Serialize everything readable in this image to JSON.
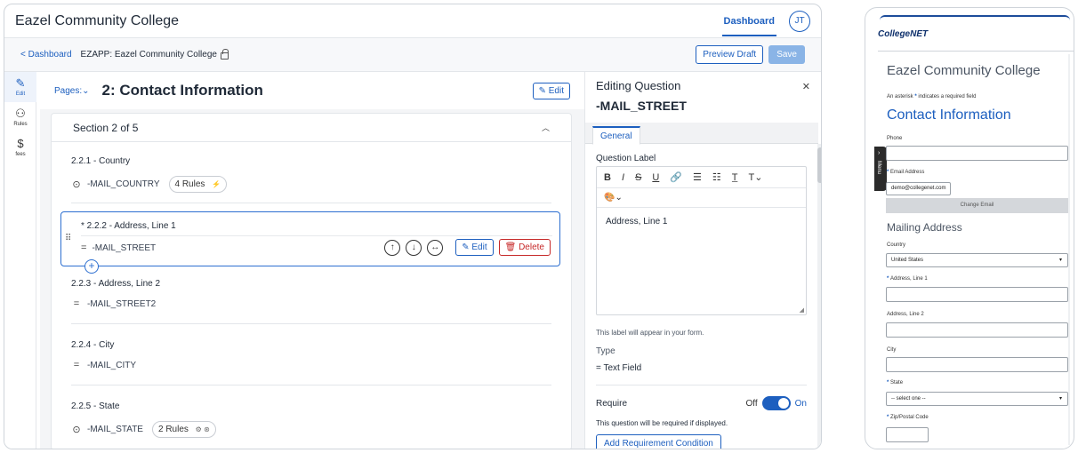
{
  "app": {
    "title": "Eazel Community College",
    "nav_dashboard": "Dashboard",
    "avatar_initials": "JT"
  },
  "breadcrumb": {
    "back_link": "< Dashboard",
    "current": "EZAPP: Eazel Community College"
  },
  "toolbar": {
    "preview_label": "Preview Draft",
    "save_label": "Save"
  },
  "rail": {
    "items": [
      {
        "icon": "pencil-icon",
        "glyph": "✎",
        "label": "Edit"
      },
      {
        "icon": "rules-icon",
        "glyph": "⚇",
        "label": "Rules"
      },
      {
        "icon": "dollar-icon",
        "glyph": "$",
        "label": "fees"
      }
    ]
  },
  "page": {
    "pages_dropdown": "Pages:⌄",
    "title": "2: Contact Information",
    "edit_label": "✎ Edit"
  },
  "section": {
    "title": "Section 2 of 5"
  },
  "questions": [
    {
      "label": "2.2.1 - Country",
      "field_icon": "dropdown-icon",
      "glyph": "⌄",
      "field": "-MAIL_COUNTRY",
      "rules": "4 Rules",
      "rule_icon": "⚡"
    },
    {
      "label": "* 2.2.2 - Address, Line 1",
      "field_icon": "text-field-icon",
      "glyph": "=",
      "field": "-MAIL_STREET",
      "selected": true
    },
    {
      "label": "2.2.3 - Address, Line 2",
      "field_icon": "text-field-icon",
      "glyph": "=",
      "field": "-MAIL_STREET2"
    },
    {
      "label": "2.2.4 - City",
      "field_icon": "text-field-icon",
      "glyph": "=",
      "field": "-MAIL_CITY"
    },
    {
      "label": "2.2.5 - State",
      "field_icon": "dropdown-icon",
      "glyph": "⌄",
      "field": "-MAIL_STATE",
      "rules": "2 Rules",
      "rule_icon": "⚙ ⊛"
    }
  ],
  "selected_actions": {
    "edit_label": "✎ Edit",
    "delete_label": "🗑 Delete"
  },
  "editor": {
    "heading": "Editing Question",
    "question_name": "-MAIL_STREET",
    "tab": "General",
    "question_label_caption": "Question Label",
    "rte_tools": [
      "B",
      "I",
      "S",
      "U",
      "🔗",
      "☰",
      "☷",
      "T̲",
      "T⌄"
    ],
    "rte_color": "🎨⌄",
    "rte_content": "Address, Line 1",
    "label_help": "This label will appear in your form.",
    "type_caption": "Type",
    "type_value": "= Text Field",
    "require_caption": "Require",
    "toggle_off": "Off",
    "toggle_on": "On",
    "require_help": "This question will be required if displayed.",
    "add_condition": "Add Requirement Condition"
  },
  "preview": {
    "logo": "CollegeNET",
    "college": "Eazel Community College",
    "asterisk_note_prefix": "An asterisk ",
    "asterisk_note_suffix": " indicates a required field",
    "section_title": "Contact Information",
    "phone_label": "Phone",
    "email_label": "Email Address",
    "email_value": "demo@collegenet.com",
    "change_email": "Change Email",
    "mailing_title": "Mailing Address",
    "country_label": "Country",
    "country_value": "United States",
    "addr1_label": "Address, Line 1",
    "addr2_label": "Address, Line 2",
    "city_label": "City",
    "state_label": "State",
    "state_value": "-- select one --",
    "zip_label": "Zip/Postal Code",
    "menu_label": "Menu"
  },
  "colors": {
    "accent": "#1d5fbf",
    "danger": "#c62828",
    "selection_border": "#2d6fd0"
  }
}
